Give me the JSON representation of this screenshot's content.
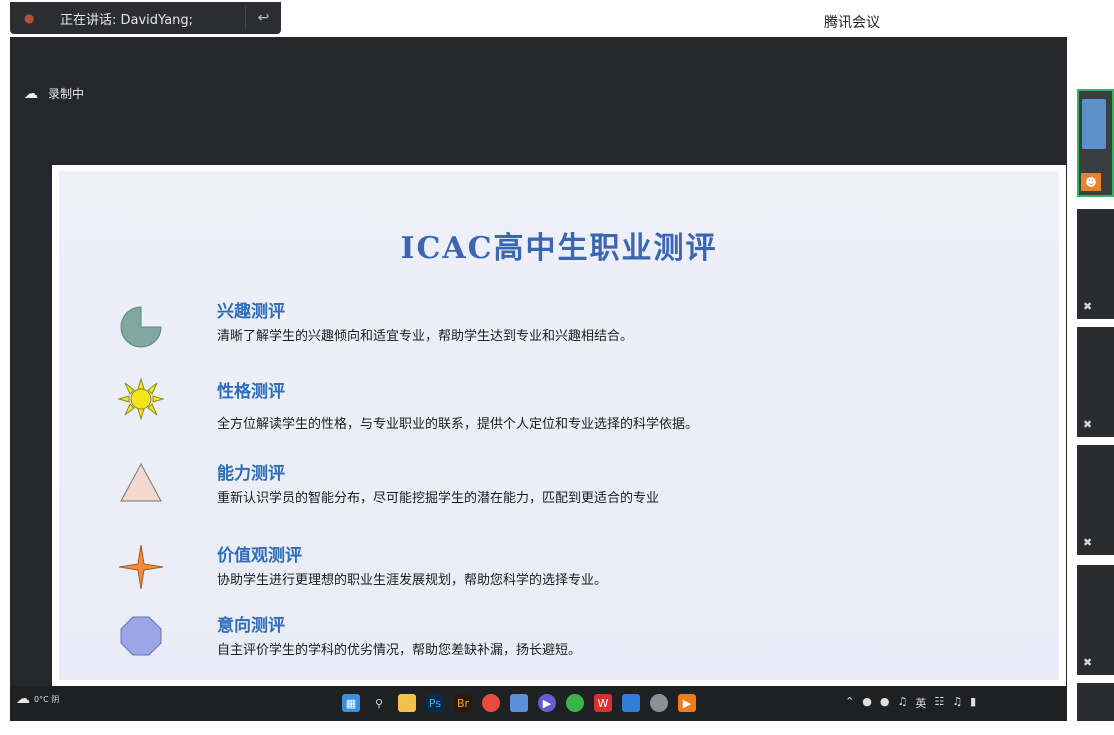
{
  "window": {
    "app_title": "腾讯会议"
  },
  "speaking": {
    "label": "正在讲话: DavidYang;"
  },
  "recording": {
    "label": "录制中"
  },
  "slide": {
    "title": "ICAC高中生职业测评",
    "items": [
      {
        "name": "兴趣测评",
        "desc": "清晰了解学生的兴趣倾向和适宜专业，帮助学生达到专业和兴趣相结合。",
        "icon": "pie-chart-icon",
        "color": "#7fa9a0"
      },
      {
        "name": "性格测评",
        "desc": "全方位解读学生的性格，与专业职业的联系，提供个人定位和专业选择的科学依据。",
        "icon": "sun-icon",
        "color": "#f4e51a"
      },
      {
        "name": "能力测评",
        "desc": "重新认识学员的智能分布，尽可能挖掘学生的潜在能力，匹配到更适合的专业",
        "icon": "triangle-icon",
        "color": "#f3d8cf"
      },
      {
        "name": "价值观测评",
        "desc": "协助学生进行更理想的职业生涯发展规划，帮助您科学的选择专业。",
        "icon": "four-point-star-icon",
        "color": "#ee8e3c"
      },
      {
        "name": "意向测评",
        "desc": "自主评价学生的学科的优劣情况，帮助您差缺补漏，扬长避短。",
        "icon": "octagon-icon",
        "color": "#9aa6e6"
      }
    ]
  },
  "taskbar": {
    "weather": "0°C 阴",
    "tray_language": "英"
  }
}
